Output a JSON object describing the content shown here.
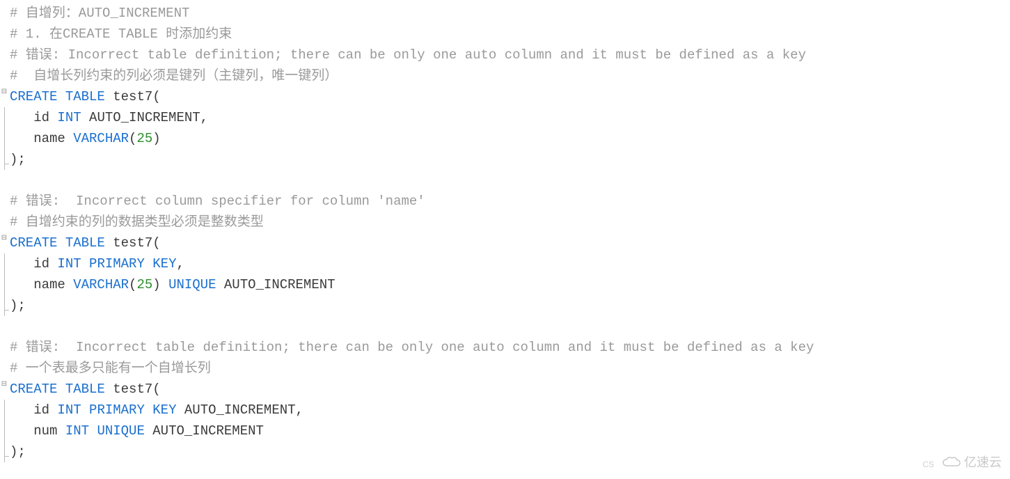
{
  "code": {
    "lines": [
      {
        "type": "comment",
        "raw": "# 自增列：AUTO_INCREMENT"
      },
      {
        "type": "comment",
        "raw": "# 1. 在CREATE TABLE 时添加约束"
      },
      {
        "type": "comment",
        "raw": "# 错误: Incorrect table definition; there can be only one auto column and it must be defined as a key"
      },
      {
        "type": "comment",
        "raw": "#  自增长列约束的列必须是键列（主键列，唯一键列）"
      },
      {
        "type": "stmt-start",
        "tokens": [
          {
            "t": "keyword",
            "v": "CREATE"
          },
          {
            "t": "space",
            "v": " "
          },
          {
            "t": "keyword",
            "v": "TABLE"
          },
          {
            "t": "space",
            "v": " "
          },
          {
            "t": "text",
            "v": "test7("
          }
        ]
      },
      {
        "type": "stmt",
        "tokens": [
          {
            "t": "text",
            "v": "   id "
          },
          {
            "t": "keyword",
            "v": "INT"
          },
          {
            "t": "text",
            "v": " AUTO_INCREMENT,"
          }
        ]
      },
      {
        "type": "stmt",
        "tokens": [
          {
            "t": "text",
            "v": "   name "
          },
          {
            "t": "keyword",
            "v": "VARCHAR"
          },
          {
            "t": "text",
            "v": "("
          },
          {
            "t": "number",
            "v": "25"
          },
          {
            "t": "text",
            "v": ")"
          }
        ]
      },
      {
        "type": "stmt-end",
        "tokens": [
          {
            "t": "text",
            "v": ");"
          }
        ]
      },
      {
        "type": "blank",
        "raw": ""
      },
      {
        "type": "comment",
        "raw": "# 错误:  Incorrect column specifier for column 'name'"
      },
      {
        "type": "comment",
        "raw": "# 自增约束的列的数据类型必须是整数类型"
      },
      {
        "type": "stmt-start",
        "tokens": [
          {
            "t": "keyword",
            "v": "CREATE"
          },
          {
            "t": "space",
            "v": " "
          },
          {
            "t": "keyword",
            "v": "TABLE"
          },
          {
            "t": "space",
            "v": " "
          },
          {
            "t": "text",
            "v": "test7("
          }
        ]
      },
      {
        "type": "stmt",
        "tokens": [
          {
            "t": "text",
            "v": "   id "
          },
          {
            "t": "keyword",
            "v": "INT"
          },
          {
            "t": "space",
            "v": " "
          },
          {
            "t": "keyword",
            "v": "PRIMARY"
          },
          {
            "t": "space",
            "v": " "
          },
          {
            "t": "keyword",
            "v": "KEY"
          },
          {
            "t": "text",
            "v": ","
          }
        ]
      },
      {
        "type": "stmt",
        "tokens": [
          {
            "t": "text",
            "v": "   name "
          },
          {
            "t": "keyword",
            "v": "VARCHAR"
          },
          {
            "t": "text",
            "v": "("
          },
          {
            "t": "number",
            "v": "25"
          },
          {
            "t": "text",
            "v": ") "
          },
          {
            "t": "keyword",
            "v": "UNIQUE"
          },
          {
            "t": "text",
            "v": " AUTO_INCREMENT"
          }
        ]
      },
      {
        "type": "stmt-end",
        "tokens": [
          {
            "t": "text",
            "v": ");"
          }
        ]
      },
      {
        "type": "blank",
        "raw": ""
      },
      {
        "type": "comment",
        "raw": "# 错误:  Incorrect table definition; there can be only one auto column and it must be defined as a key"
      },
      {
        "type": "comment",
        "raw": "# 一个表最多只能有一个自增长列"
      },
      {
        "type": "stmt-start",
        "tokens": [
          {
            "t": "keyword",
            "v": "CREATE"
          },
          {
            "t": "space",
            "v": " "
          },
          {
            "t": "keyword",
            "v": "TABLE"
          },
          {
            "t": "space",
            "v": " "
          },
          {
            "t": "text",
            "v": "test7("
          }
        ]
      },
      {
        "type": "stmt",
        "tokens": [
          {
            "t": "text",
            "v": "   id "
          },
          {
            "t": "keyword",
            "v": "INT"
          },
          {
            "t": "space",
            "v": " "
          },
          {
            "t": "keyword",
            "v": "PRIMARY"
          },
          {
            "t": "space",
            "v": " "
          },
          {
            "t": "keyword",
            "v": "KEY"
          },
          {
            "t": "text",
            "v": " AUTO_INCREMENT,"
          }
        ]
      },
      {
        "type": "stmt",
        "tokens": [
          {
            "t": "text",
            "v": "   num "
          },
          {
            "t": "keyword",
            "v": "INT"
          },
          {
            "t": "space",
            "v": " "
          },
          {
            "t": "keyword",
            "v": "UNIQUE"
          },
          {
            "t": "text",
            "v": " AUTO_INCREMENT"
          }
        ]
      },
      {
        "type": "stmt-end",
        "tokens": [
          {
            "t": "text",
            "v": ");"
          }
        ]
      }
    ]
  },
  "watermark": "亿速云",
  "corner_small": "CS"
}
